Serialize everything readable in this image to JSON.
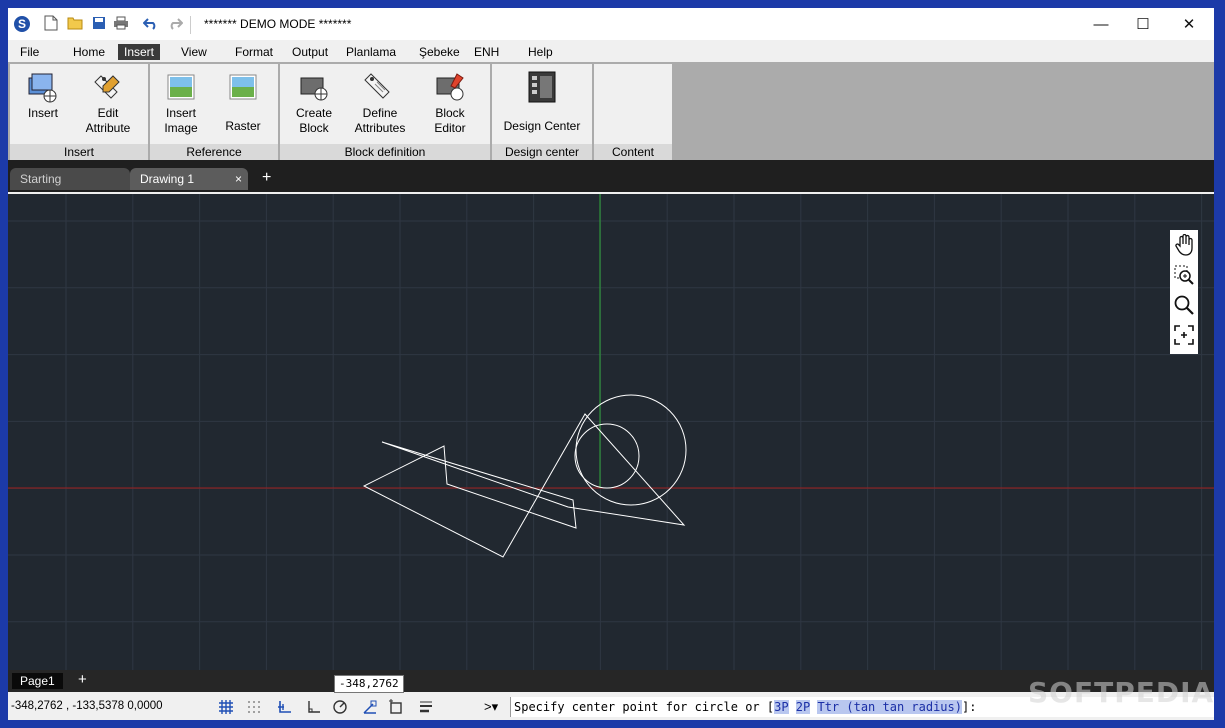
{
  "window": {
    "title": "******* DEMO MODE *******",
    "minimize": "—",
    "maximize": "☐",
    "close": "✕"
  },
  "quick_access": [
    "new-file",
    "open-folder",
    "save",
    "print",
    "undo",
    "redo"
  ],
  "menu": [
    "File",
    "Home",
    "Insert",
    "View",
    "Format",
    "Output",
    "Planlama",
    "Şebeke",
    "ENH",
    "Help"
  ],
  "active_menu": "Insert",
  "ribbon": {
    "panels": [
      {
        "label": "Insert",
        "buttons": [
          "Insert",
          "Edit\nAttribute"
        ]
      },
      {
        "label": "Reference",
        "buttons": [
          "Insert\nImage",
          "Raster"
        ]
      },
      {
        "label": "Block definition",
        "buttons": [
          "Create\nBlock",
          "Define\nAttributes",
          "Block\nEditor"
        ]
      },
      {
        "label": "Design center",
        "buttons": [
          "Design Center"
        ]
      },
      {
        "label": "Content",
        "buttons": []
      }
    ]
  },
  "doc_tabs": [
    {
      "label": "Starting"
    },
    {
      "label": "Drawing 1"
    }
  ],
  "doc_tab_close": "×",
  "add_symbol": "+",
  "layout_tabs": [
    {
      "label": "Page1"
    }
  ],
  "coord_tooltip": "-348,2762",
  "status": {
    "coords": "-348,2762 , -133,5378  0,0000",
    "prompt_symbol": ">▾"
  },
  "command": {
    "text": "Specify center point for circle or [",
    "options": [
      "3P",
      "2P",
      "Ttr (tan tan radius)"
    ],
    "suffix": "]:"
  },
  "watermark": "SOFTPEDIA",
  "colors": {
    "canvas": "#212830",
    "grid": "#2f3743",
    "x_axis": "#a02020",
    "y_axis": "#2fa83a",
    "geometry": "#ffffff",
    "desktop": "#1c3aa8"
  }
}
